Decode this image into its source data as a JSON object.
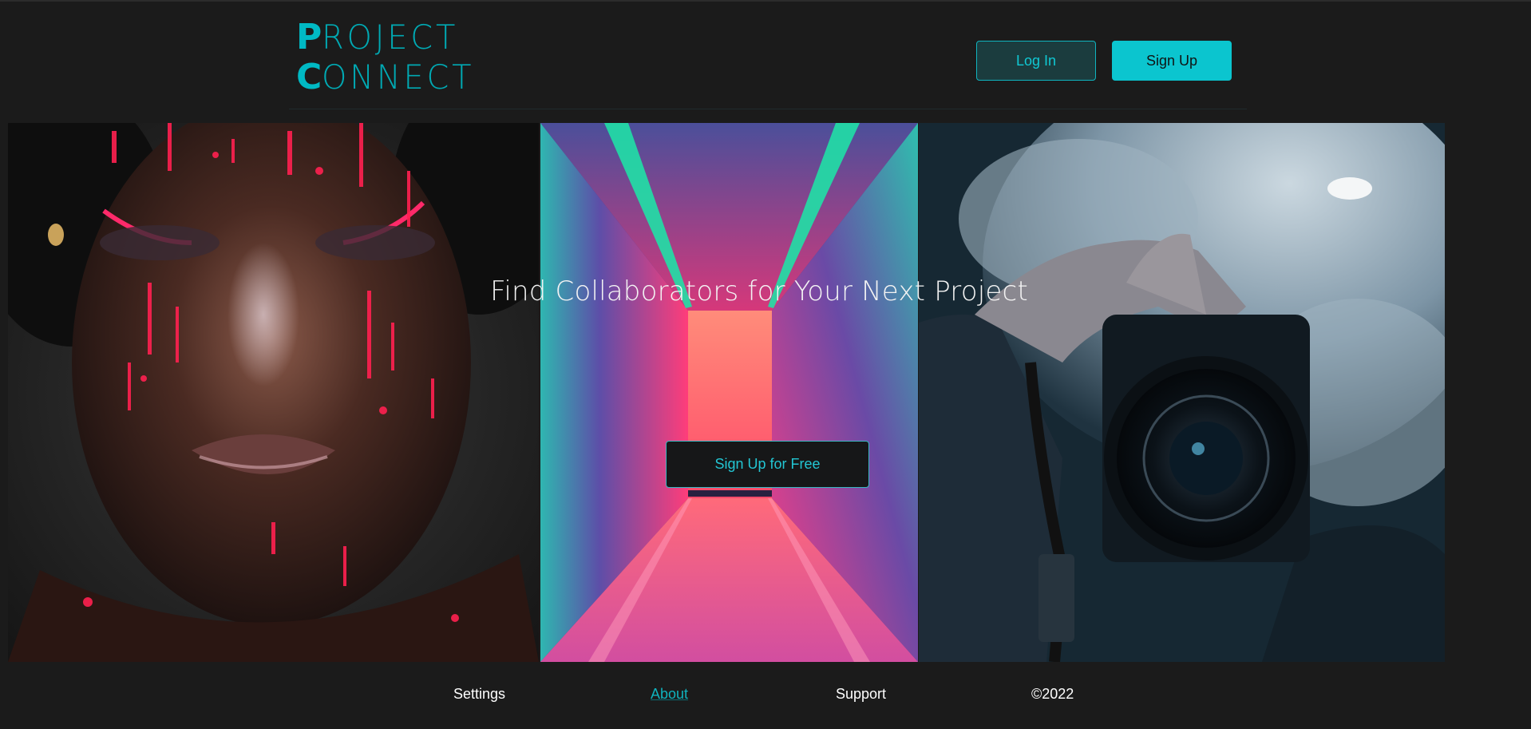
{
  "header": {
    "logo": {
      "line1_initial": "P",
      "line1_rest": "ROJECT",
      "line2_initial": "C",
      "line2_rest": "ONNECT"
    },
    "login_label": "Log In",
    "signup_label": "Sign Up"
  },
  "hero": {
    "title": "Find Collaborators for Your Next Project",
    "cta_label": "Sign Up for Free",
    "images": [
      "face-neon-paint-image",
      "neon-corridor-image",
      "camera-in-smoke-image"
    ]
  },
  "footer": {
    "settings": "Settings",
    "about": "About",
    "support": "Support",
    "copyright": "©2022"
  },
  "colors": {
    "background": "#1b1b1b",
    "accent": "#0bc5cf",
    "accent_dark": "#1b3c3e"
  }
}
